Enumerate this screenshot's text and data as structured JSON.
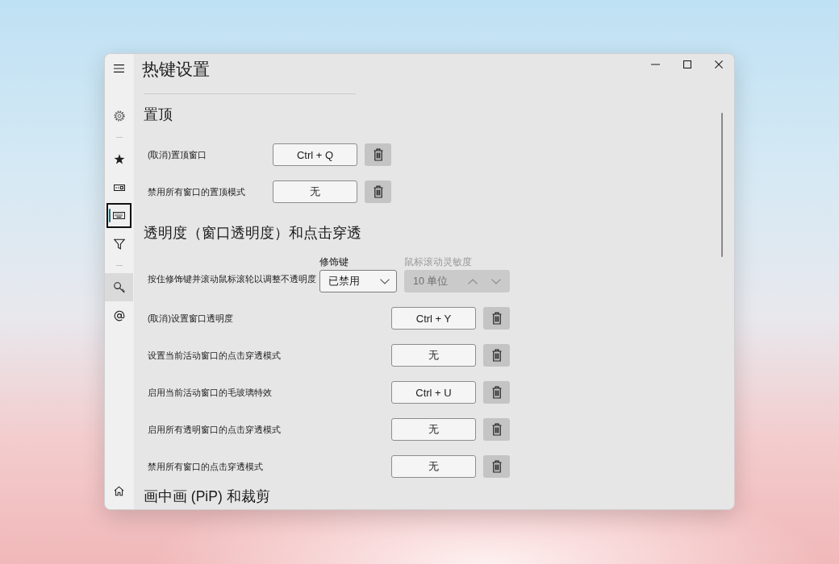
{
  "window": {
    "title": "热键设置"
  },
  "sidebar": {
    "items": [
      {
        "kind": "nav",
        "selected": false,
        "highlighted": false
      },
      {
        "kind": "divider"
      },
      {
        "kind": "nav",
        "selected": false,
        "highlighted": false
      },
      {
        "kind": "nav",
        "selected": false,
        "highlighted": false
      },
      {
        "kind": "nav",
        "selected": true,
        "highlighted": false
      },
      {
        "kind": "nav",
        "selected": false,
        "highlighted": false
      },
      {
        "kind": "divider"
      },
      {
        "kind": "nav",
        "selected": false,
        "highlighted": true
      },
      {
        "kind": "nav",
        "selected": false,
        "highlighted": false
      }
    ]
  },
  "sections": [
    {
      "heading": "置顶",
      "rows": [
        {
          "kind": "hotkey",
          "label": "(取消)置顶窗口",
          "hotkey": "Ctrl + Q"
        },
        {
          "kind": "hotkey",
          "label": "禁用所有窗口的置顶模式",
          "hotkey": "无"
        }
      ]
    },
    {
      "heading": "透明度（窗口透明度）和点击穿透",
      "rows": [
        {
          "kind": "modifier",
          "label": "按住修饰键并滚动鼠标滚轮以调整不透明度",
          "modifier": {
            "label": "修饰键",
            "value": "已禁用"
          },
          "sensitivity": {
            "label": "鼠标滚动灵敏度",
            "value": "10 单位",
            "disabled": true
          }
        },
        {
          "kind": "hotkey",
          "label": "(取消)设置窗口透明度",
          "hotkey": "Ctrl + Y"
        },
        {
          "kind": "hotkey",
          "label": "设置当前活动窗口的点击穿透模式",
          "hotkey": "无"
        },
        {
          "kind": "hotkey",
          "label": "启用当前活动窗口的毛玻璃特效",
          "hotkey": "Ctrl + U"
        },
        {
          "kind": "hotkey",
          "label": "启用所有透明窗口的点击穿透模式",
          "hotkey": "无"
        },
        {
          "kind": "hotkey",
          "label": "禁用所有窗口的点击穿透模式",
          "hotkey": "无"
        }
      ]
    },
    {
      "heading": "画中画 (PiP) 和裁剪"
    }
  ]
}
